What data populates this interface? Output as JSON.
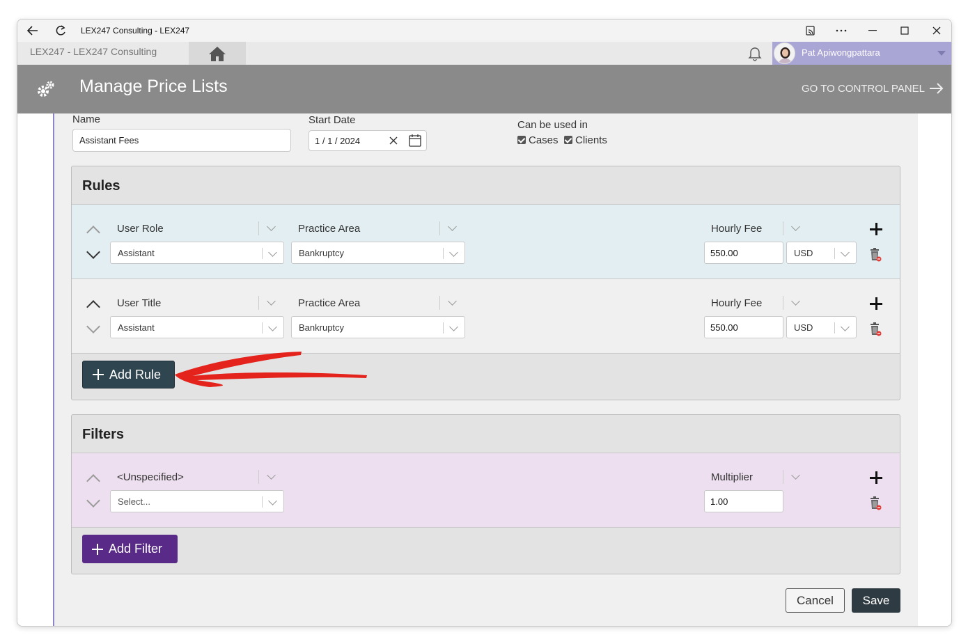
{
  "window": {
    "title": "LEX247 Consulting - LEX247"
  },
  "appbar": {
    "breadcrumb": "LEX247  -  LEX247 Consulting",
    "user_name": "Pat Apiwongpattara"
  },
  "header": {
    "title": "Manage Price Lists",
    "control_panel_link": "GO TO CONTROL PANEL"
  },
  "form": {
    "name_label": "Name",
    "name_value": "Assistant Fees",
    "start_date_label": "Start Date",
    "start_date_value": "1 / 1 / 2024",
    "usage_label": "Can be used in",
    "usage_options": [
      {
        "label": "Cases",
        "checked": true
      },
      {
        "label": "Clients",
        "checked": true
      }
    ]
  },
  "rules": {
    "title": "Rules",
    "rows": [
      {
        "criterion": "User Role",
        "criterion_value": "Assistant",
        "area_label": "Practice Area",
        "area_value": "Bankruptcy",
        "fee_label": "Hourly Fee",
        "fee_value": "550.00",
        "currency": "USD"
      },
      {
        "criterion": "User Title",
        "criterion_value": "Assistant",
        "area_label": "Practice Area",
        "area_value": "Bankruptcy",
        "fee_label": "Hourly Fee",
        "fee_value": "550.00",
        "currency": "USD"
      }
    ],
    "add_button": "Add Rule"
  },
  "filters": {
    "title": "Filters",
    "rows": [
      {
        "criterion": "<Unspecified>",
        "criterion_placeholder": "Select...",
        "value_label": "Multiplier",
        "value": "1.00"
      }
    ],
    "add_button": "Add Filter"
  },
  "footer": {
    "cancel": "Cancel",
    "save": "Save"
  },
  "colors": {
    "header_bg": "#8a8a8a",
    "user_box": "#a9a6d6",
    "rule_row_1": "#e2eef2",
    "rule_row_2": "#f0f0f0",
    "filter_row": "#eddff0",
    "add_rule_btn": "#2f4550",
    "add_filter_btn": "#5a2a88",
    "save_btn": "#2f3b42",
    "annotation_arrow": "#e3231c"
  }
}
